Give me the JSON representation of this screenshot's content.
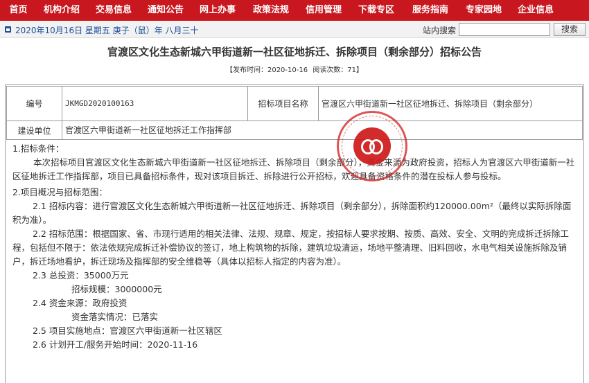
{
  "nav": {
    "items": [
      {
        "label": "首页"
      },
      {
        "label": "机构介绍"
      },
      {
        "label": "交易信息"
      },
      {
        "label": "通知公告"
      },
      {
        "label": "网上办事"
      },
      {
        "label": "政策法规"
      },
      {
        "label": "信用管理"
      },
      {
        "label": "下载专区"
      },
      {
        "label": "服务指南"
      },
      {
        "label": "专家园地"
      },
      {
        "label": "企业信息"
      }
    ]
  },
  "infobar": {
    "date": "2020年10月16日  星期五  庚子（鼠）年  八月三十",
    "search_label": "站内搜索",
    "search_value": "",
    "search_button": "搜索"
  },
  "article": {
    "title": "官渡区文化生态新城六甲街道新一社区征地拆迁、拆除项目（剩余部分）招标公告",
    "published": "【发布时间：2020-10-16",
    "read_count": "阅读次数：71】"
  },
  "info_table": {
    "code_label": "编号",
    "code_value": "JKMGD2020100163",
    "project_name_label": "招标项目名称",
    "project_name_value": "官渡区六甲街道新一社区征地拆迁、拆除项目（剩余部分）",
    "unit_label": "建设单位",
    "unit_value": "官渡区六甲街道新一社区征地拆迁工作指挥部"
  },
  "body": {
    "s1_title": "1.招标条件：",
    "s1_text": "本次招标项目官渡区文化生态新城六甲街道新一社区征地拆迁、拆除项目（剩余部分），资金来源为政府投资，招标人为官渡区六甲街道新一社区征地拆迁工作指挥部，项目已具备招标条件，现对该项目拆迁、拆除进行公开招标，欢迎具备资格条件的潜在投标人参与投标。",
    "s2_title": "2.项目概况与招标范围：",
    "s2_1": "2.1 招标内容：进行官渡区文化生态新城六甲街道新一社区征地拆迁、拆除项目（剩余部分），拆除面积约120000.00m²（最终以实际拆除面积为准）。",
    "s2_2": "2.2 招标范围：根据国家、省、市现行适用的相关法律、法规、规章、规定，按招标人要求按期、按质、高效、安全、文明的完成拆迁拆除工程，包括但不限于：依法依规完成拆迁补偿协议的签订，地上构筑物的拆除，建筑垃圾清运，场地平整清理、旧料回收，水电气相关设施拆除及销户，拆迁场地看护，拆迁现场及指挥部的安全维稳等（具体以招标人指定的内容为准）。",
    "s2_3": "2.3 总投资：35000万元",
    "s2_3b": "招标规模：3000000元",
    "s2_4": "2.4 资金来源：政府投资",
    "s2_4b": "资金落实情况：已落实",
    "s2_5": "2.5 项目实施地点：官渡区六甲街道新一社区辖区",
    "s2_6": "2.6 计划开工/服务开始时间：2020-11-16"
  },
  "colors": {
    "nav_bg": "#c8171e",
    "date_text": "#1a4d9a",
    "seal": "#cd1919"
  }
}
